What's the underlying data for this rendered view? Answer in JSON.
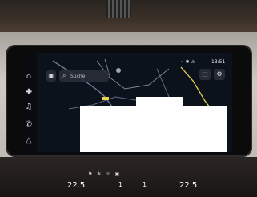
{
  "nav": {
    "search_placeholder": "Suche",
    "status_time": "13:51"
  },
  "climate": {
    "temp_left": "22.5",
    "temp_right": "22.5",
    "fan_left": "1",
    "fan_right": "1"
  },
  "colors": {
    "map_background": "#0c121c",
    "route_line": "#e8d44a",
    "cabin_trim": "#cfcbc4"
  },
  "icons": [
    "home-icon",
    "navigation-icon",
    "phone-icon",
    "music-icon",
    "search-icon",
    "gear-icon",
    "map-pin-icon"
  ]
}
